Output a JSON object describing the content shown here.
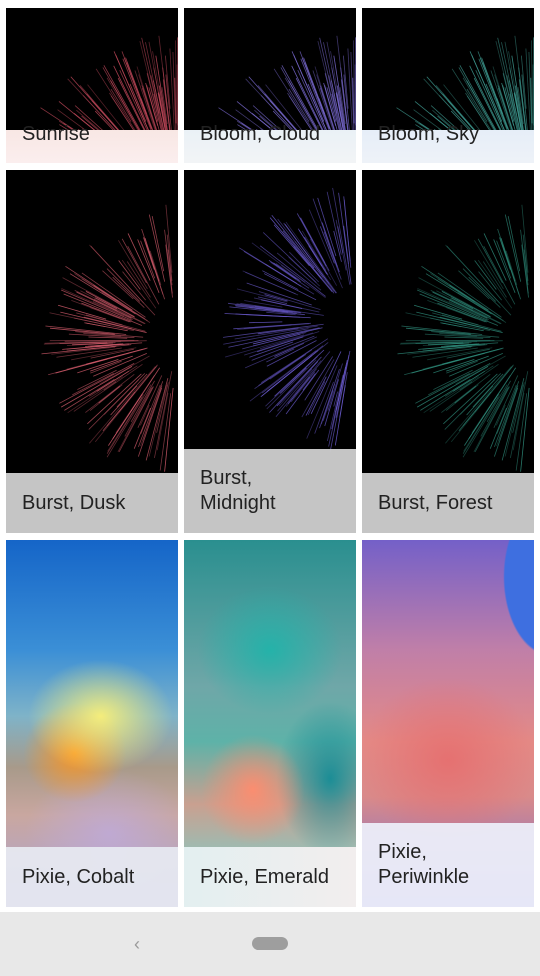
{
  "wallpapers": [
    {
      "id": "sunrise",
      "label": "Sunrise"
    },
    {
      "id": "cloud",
      "label": "Bloom, Cloud"
    },
    {
      "id": "sky",
      "label": "Bloom, Sky"
    },
    {
      "id": "dusk",
      "label_lines": [
        "Burst, Dusk"
      ]
    },
    {
      "id": "midnight",
      "label_lines": [
        "Burst,",
        "Midnight"
      ]
    },
    {
      "id": "forest",
      "label_lines": [
        "Burst, Forest"
      ]
    },
    {
      "id": "cobalt",
      "label_lines": [
        "Pixie, Cobalt"
      ]
    },
    {
      "id": "emerald",
      "label_lines": [
        "Pixie, Emerald"
      ]
    },
    {
      "id": "peri",
      "label_lines": [
        "Pixie,",
        "Periwinkle"
      ]
    }
  ],
  "colors": {
    "burst_dusk": "#d05a6a",
    "burst_midnight": "#6a5acd",
    "burst_forest": "#2e8b7a",
    "bloom_sunrise": "#c0485a",
    "bloom_cloud": "#7a6ad0",
    "bloom_sky": "#3e9a90"
  },
  "nav": {
    "back_icon": "back-chevron-icon",
    "home_icon": "home-pill-icon"
  }
}
